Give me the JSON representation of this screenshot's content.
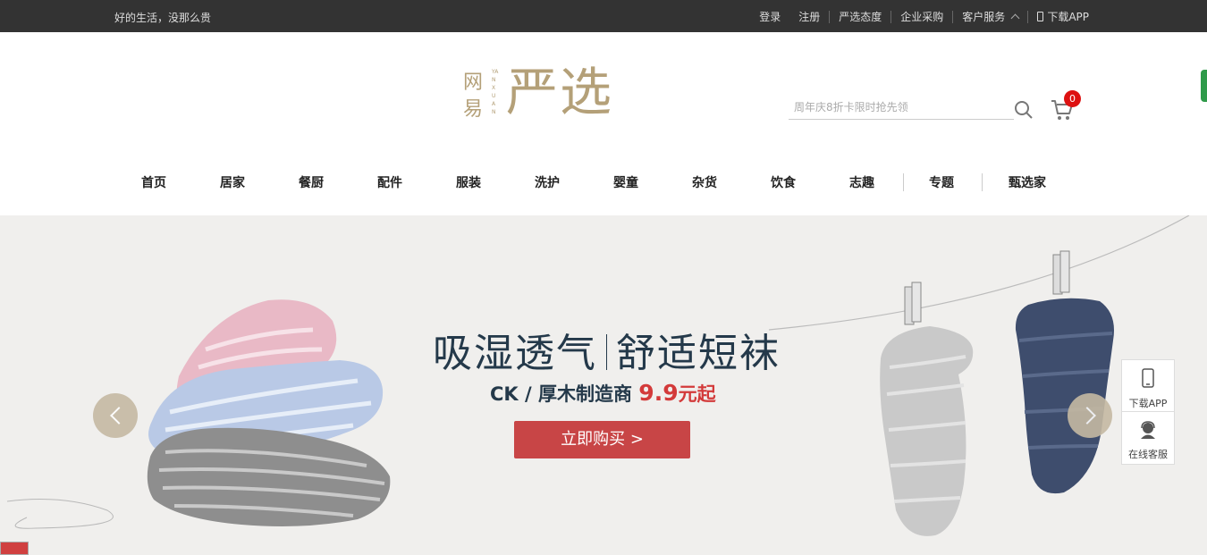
{
  "topbar": {
    "slogan": "好的生活，没那么贵",
    "login": "登录",
    "register": "注册",
    "attitude": "严选态度",
    "enterprise": "企业采购",
    "service": "客户服务",
    "download_app": "下载APP"
  },
  "logo": {
    "char1": "网",
    "char2": "易",
    "pinyin": "YANXUAN",
    "main": "严选"
  },
  "search": {
    "placeholder": "周年庆8折卡限时抢先领"
  },
  "cart": {
    "count": "0"
  },
  "nav": {
    "items": [
      "首页",
      "居家",
      "餐厨",
      "配件",
      "服装",
      "洗护",
      "婴童",
      "杂货",
      "饮食",
      "志趣",
      "专题",
      "甄选家"
    ]
  },
  "banner": {
    "headline_left": "吸湿透气",
    "headline_right": "舒适短袜",
    "brand": "CK",
    "slash": "/",
    "maker": "厚木制造商",
    "price": "9.9",
    "price_unit": "元起",
    "cta": "立即购买 >"
  },
  "side_widget": {
    "download": "下载APP",
    "service": "在线客服"
  },
  "colors": {
    "topbar_bg": "#333333",
    "logo_gold": "#b4a078",
    "cta_red": "#c84546",
    "price_red": "#d33a3a",
    "headline": "#24394a",
    "badge_red": "#dd1111",
    "arrow_bg": "#c5b9a3"
  },
  "icons": {
    "search": "search-icon",
    "cart": "cart-icon",
    "phone": "phone-icon",
    "chevron": "chevron-up-icon",
    "headset": "customer-service-icon"
  }
}
